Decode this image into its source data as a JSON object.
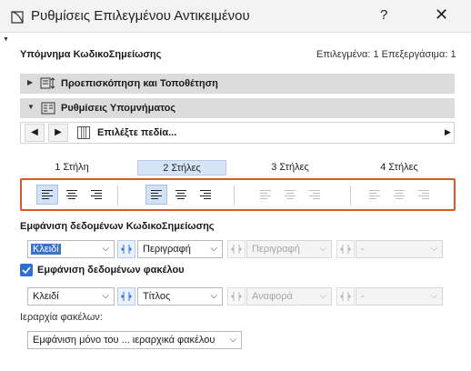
{
  "window": {
    "title": "Ρυθμίσεις Επιλεγμένου Αντικειμένου",
    "help_label": "?",
    "close_label": "✕"
  },
  "header": {
    "object_name": "Υπόμνημα ΚωδικοΣημείωσης",
    "selection_status": "Επιλεγμένα: 1 Επεξεργάσιμα: 1"
  },
  "sections": [
    {
      "label": "Προεπισκόπηση και Τοποθέτηση",
      "expanded": false,
      "icon": "preview-placement-icon"
    },
    {
      "label": "Ρυθμίσεις Υπομνήματος",
      "expanded": true,
      "icon": "legend-settings-icon"
    }
  ],
  "navigator": {
    "prev_label": "◀",
    "next_label": "▶",
    "fields_label": "Επιλέξτε πεδία...",
    "more_label": "▶"
  },
  "column_tabs": [
    {
      "label": "1 Στήλη",
      "active": false
    },
    {
      "label": "2 Στήλες",
      "active": true
    },
    {
      "label": "3 Στήλες",
      "active": false
    },
    {
      "label": "4 Στήλες",
      "active": false
    }
  ],
  "alignment_groups": [
    {
      "enabled": true,
      "selected": "left"
    },
    {
      "enabled": true,
      "selected": "left"
    },
    {
      "enabled": false,
      "selected": ""
    },
    {
      "enabled": false,
      "selected": ""
    }
  ],
  "keynote_data": {
    "label": "Εμφάνιση δεδομένων ΚωδικοΣημείωσης",
    "dropdowns": [
      {
        "value": "Κλειδί",
        "enabled": true,
        "highlighted": true
      },
      {
        "value": "Περιγραφή",
        "enabled": true,
        "highlighted": false
      },
      {
        "value": "Περιγραφή",
        "enabled": false,
        "highlighted": false
      },
      {
        "value": "-",
        "enabled": false,
        "highlighted": false
      }
    ]
  },
  "folder_data": {
    "label": "Εμφάνιση δεδομένων φακέλου",
    "checked": true,
    "dropdowns": [
      {
        "value": "Κλειδί",
        "enabled": true
      },
      {
        "value": "Τίτλος",
        "enabled": true
      },
      {
        "value": "Αναφορά",
        "enabled": false
      },
      {
        "value": "-",
        "enabled": false
      }
    ]
  },
  "folder_hierarchy": {
    "label": "Ιεραρχία φακέλων:",
    "value": "Εμφάνιση μόνο του ... ιεραρχικά φακέλου"
  },
  "colors": {
    "accent": "#2f6fd0",
    "highlight_border": "#d9592b",
    "selected_bg": "#d2e2f6"
  }
}
